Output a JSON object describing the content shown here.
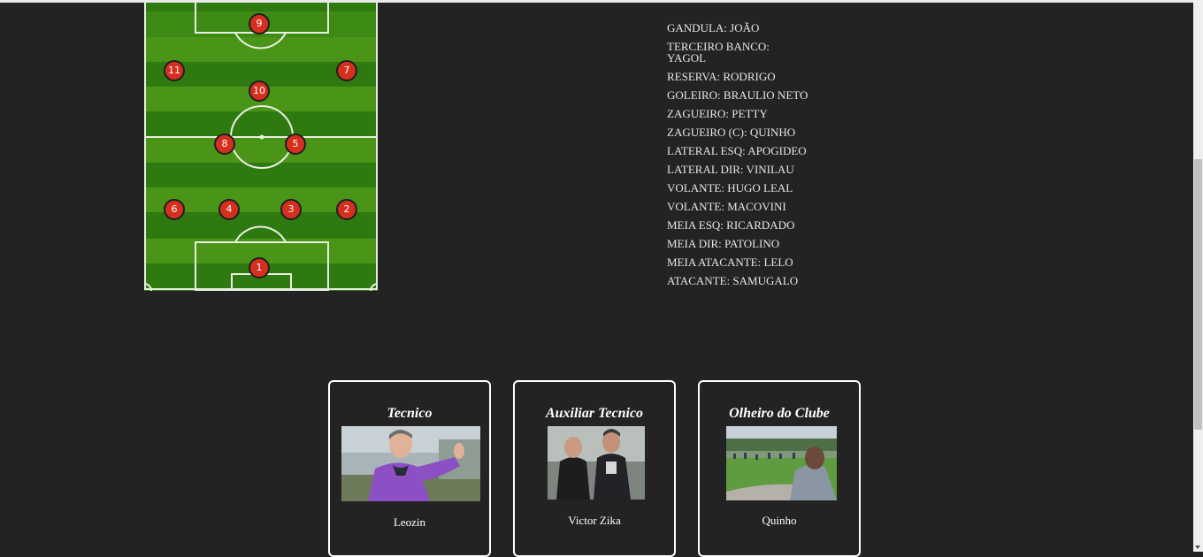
{
  "formation": {
    "players": [
      {
        "number": "9"
      },
      {
        "number": "11"
      },
      {
        "number": "7"
      },
      {
        "number": "10"
      },
      {
        "number": "8"
      },
      {
        "number": "5"
      },
      {
        "number": "6"
      },
      {
        "number": "4"
      },
      {
        "number": "3"
      },
      {
        "number": "2"
      },
      {
        "number": "1"
      }
    ]
  },
  "roster": [
    "GANDULA: JOÃO",
    "TERCEIRO BANCO: YAGOL",
    "RESERVA: RODRIGO",
    "GOLEIRO: BRAULIO NETO",
    "ZAGUEIRO: PETTY",
    "ZAGUEIRO (C): QUINHO",
    "LATERAL ESQ: APOGIDEO",
    "LATERAL DIR: VINILAU",
    "VOLANTE: HUGO LEAL",
    "VOLANTE: MACOVINI",
    "MEIA ESQ: RICARDADO",
    "MEIA DIR: PATOLINO",
    "MEIA ATACANTE: LELO",
    "ATACANTE: SAMUGALO"
  ],
  "staff": [
    {
      "role": "Tecnico",
      "name": "Leozin"
    },
    {
      "role": "Auxiliar Tecnico",
      "name": "Victor Zika"
    },
    {
      "role": "Olheiro do Clube",
      "name": "Quinho"
    }
  ],
  "colors": {
    "background": "#232323",
    "pitch_dark": "#2f7a10",
    "pitch_light": "#4a9417",
    "player_badge": "#d42f1f",
    "text": "#e6e6e6"
  }
}
